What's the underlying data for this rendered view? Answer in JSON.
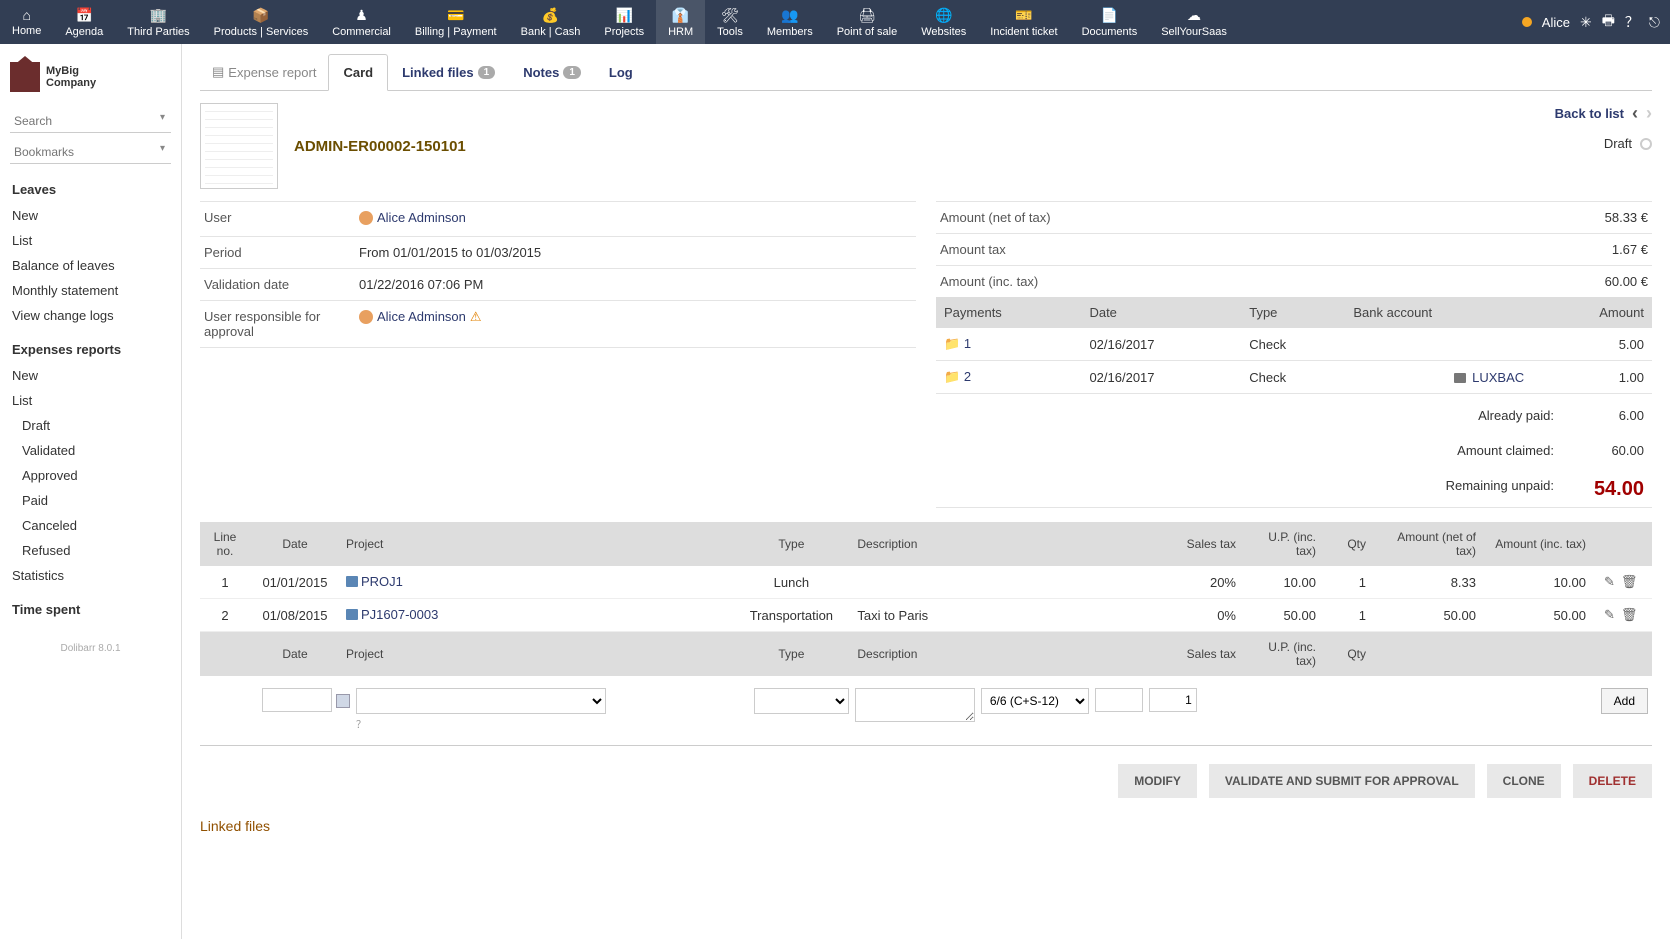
{
  "topnav": {
    "items": [
      {
        "label": "Home",
        "icon": "⌂"
      },
      {
        "label": "Agenda",
        "icon": "📅"
      },
      {
        "label": "Third Parties",
        "icon": "🏢"
      },
      {
        "label": "Products | Services",
        "icon": "📦"
      },
      {
        "label": "Commercial",
        "icon": "♟"
      },
      {
        "label": "Billing | Payment",
        "icon": "💳"
      },
      {
        "label": "Bank | Cash",
        "icon": "💰"
      },
      {
        "label": "Projects",
        "icon": "📊"
      },
      {
        "label": "HRM",
        "icon": "👔"
      },
      {
        "label": "Tools",
        "icon": "🛠"
      },
      {
        "label": "Members",
        "icon": "👥"
      },
      {
        "label": "Point of sale",
        "icon": "🖨"
      },
      {
        "label": "Websites",
        "icon": "🌐"
      },
      {
        "label": "Incident ticket",
        "icon": "🎫"
      },
      {
        "label": "Documents",
        "icon": "📄"
      },
      {
        "label": "SellYourSaas",
        "icon": "☁"
      }
    ],
    "user": "Alice"
  },
  "sidebar": {
    "logo": "MyBig\nCompany",
    "search": "Search",
    "bookmarks": "Bookmarks",
    "leaves_heading": "Leaves",
    "leaves": [
      "New",
      "List",
      "Balance of leaves",
      "Monthly statement",
      "View change logs"
    ],
    "expenses_heading": "Expenses reports",
    "expenses": [
      "New",
      "List"
    ],
    "expenses_sub": [
      "Draft",
      "Validated",
      "Approved",
      "Paid",
      "Canceled",
      "Refused"
    ],
    "stats": "Statistics",
    "time_heading": "Time spent",
    "footer": "Dolibarr 8.0.1"
  },
  "tabs": {
    "title": "Expense report",
    "card": "Card",
    "linked": "Linked files",
    "linked_badge": "1",
    "notes": "Notes",
    "notes_badge": "1",
    "log": "Log"
  },
  "header": {
    "ref": "ADMIN-ER00002-150101",
    "back": "Back to list",
    "status": "Draft"
  },
  "info_left": {
    "user_lbl": "User",
    "user_val": "Alice Adminson",
    "period_lbl": "Period",
    "period_val": "From 01/01/2015 to 01/03/2015",
    "valid_lbl": "Validation date",
    "valid_val": "01/22/2016 07:06 PM",
    "approver_lbl": "User responsible for approval",
    "approver_val": "Alice Adminson"
  },
  "info_right": {
    "net_lbl": "Amount (net of tax)",
    "net_val": "58.33 €",
    "tax_lbl": "Amount tax",
    "tax_val": "1.67 €",
    "inc_lbl": "Amount (inc. tax)",
    "inc_val": "60.00 €"
  },
  "payments": {
    "headers": [
      "Payments",
      "Date",
      "Type",
      "Bank account",
      "Amount"
    ],
    "rows": [
      {
        "n": "1",
        "date": "02/16/2017",
        "type": "Check",
        "bank": "",
        "amount": "5.00"
      },
      {
        "n": "2",
        "date": "02/16/2017",
        "type": "Check",
        "bank": "LUXBAC",
        "amount": "1.00"
      }
    ],
    "paid_lbl": "Already paid:",
    "paid_val": "6.00",
    "claimed_lbl": "Amount claimed:",
    "claimed_val": "60.00",
    "unpaid_lbl": "Remaining unpaid:",
    "unpaid_val": "54.00"
  },
  "lines": {
    "headers": {
      "line": "Line no.",
      "date": "Date",
      "project": "Project",
      "type": "Type",
      "desc": "Description",
      "tax": "Sales tax",
      "up": "U.P. (inc. tax)",
      "qty": "Qty",
      "net": "Amount (net of tax)",
      "inc": "Amount (inc. tax)"
    },
    "rows": [
      {
        "n": "1",
        "date": "01/01/2015",
        "project": "PROJ1",
        "type": "Lunch",
        "desc": "",
        "tax": "20%",
        "up": "10.00",
        "qty": "1",
        "net": "8.33",
        "inc": "10.00"
      },
      {
        "n": "2",
        "date": "01/08/2015",
        "project": "PJ1607-0003",
        "type": "Transportation",
        "desc": "Taxi to Paris",
        "tax": "0%",
        "up": "50.00",
        "qty": "1",
        "net": "50.00",
        "inc": "50.00"
      }
    ]
  },
  "addform": {
    "tax_default": "6/6 (C+S-12)",
    "qty_default": "1",
    "add_btn": "Add"
  },
  "actions": {
    "modify": "Modify",
    "validate": "Validate and submit for approval",
    "clone": "Clone",
    "delete": "Delete"
  },
  "footer_section": "Linked files"
}
